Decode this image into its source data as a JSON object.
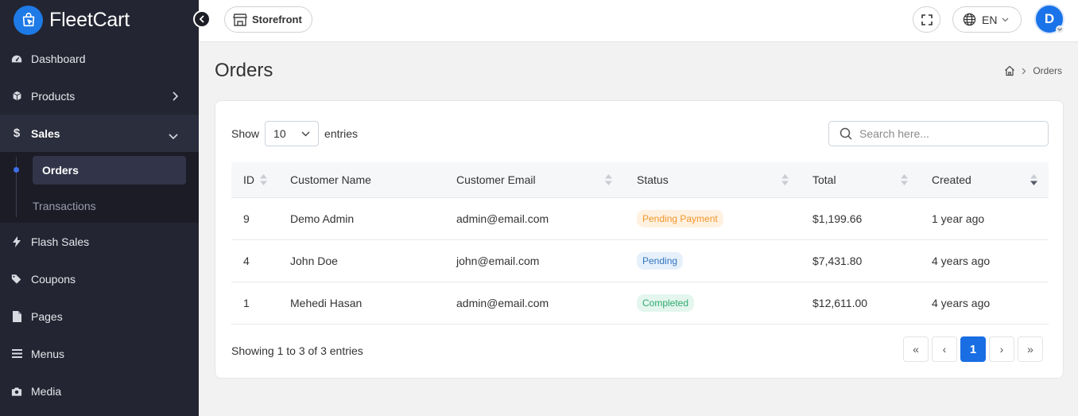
{
  "brand": {
    "name": "FleetCart"
  },
  "sidebar": {
    "items": [
      {
        "label": "Dashboard",
        "icon": "dashboard-icon"
      },
      {
        "label": "Products",
        "icon": "box-icon"
      },
      {
        "label": "Sales",
        "icon": "dollar-icon",
        "active": true
      },
      {
        "label": "Flash Sales",
        "icon": "bolt-icon"
      },
      {
        "label": "Coupons",
        "icon": "tags-icon"
      },
      {
        "label": "Pages",
        "icon": "file-icon"
      },
      {
        "label": "Menus",
        "icon": "bars-icon"
      },
      {
        "label": "Media",
        "icon": "camera-icon"
      }
    ],
    "sales_sub": [
      {
        "label": "Orders",
        "active": true
      },
      {
        "label": "Transactions"
      }
    ]
  },
  "topbar": {
    "storefront_label": "Storefront",
    "language": "EN",
    "avatar_initial": "D"
  },
  "page": {
    "title": "Orders",
    "breadcrumb_current": "Orders"
  },
  "table_controls": {
    "show_label": "Show",
    "entries_value": "10",
    "entries_label": "entries",
    "search_placeholder": "Search here..."
  },
  "table": {
    "columns": [
      "ID",
      "Customer Name",
      "Customer Email",
      "Status",
      "Total",
      "Created"
    ],
    "rows": [
      {
        "id": "9",
        "name": "Demo Admin",
        "email": "admin@email.com",
        "status": "Pending Payment",
        "total": "$1,199.66",
        "created": "1 year ago"
      },
      {
        "id": "4",
        "name": "John Doe",
        "email": "john@email.com",
        "status": "Pending",
        "total": "$7,431.80",
        "created": "4 years ago"
      },
      {
        "id": "1",
        "name": "Mehedi Hasan",
        "email": "admin@email.com",
        "status": "Completed",
        "total": "$12,611.00",
        "created": "4 years ago"
      }
    ]
  },
  "footer": {
    "info": "Showing 1 to 3 of 3 entries",
    "pager": {
      "first": "«",
      "prev": "‹",
      "current": "1",
      "next": "›",
      "last": "»"
    }
  },
  "colors": {
    "sidebar_bg": "#232532",
    "accent": "#1a6ee3",
    "pending_payment_bg": "#fff1e0",
    "pending_payment_fg": "#f0962c",
    "pending_bg": "#e6f0fb",
    "pending_fg": "#2f74c0",
    "completed_bg": "#e4f6ee",
    "completed_fg": "#2faa6e"
  }
}
